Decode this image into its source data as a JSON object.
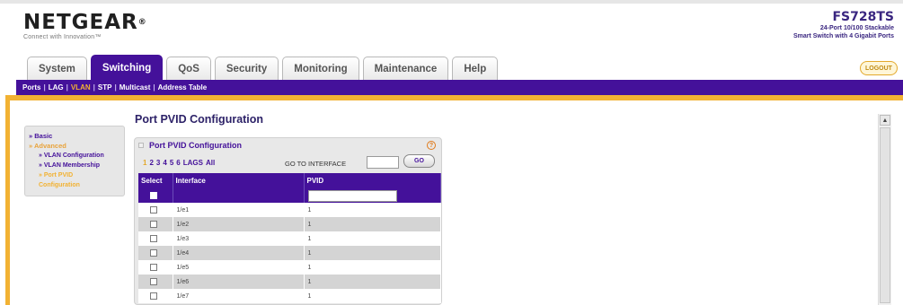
{
  "brand": {
    "logo_text": "NETGEAR",
    "logo_reg": "®",
    "tagline": "Connect with Innovation™"
  },
  "model": {
    "name": "FS728TS",
    "line1": "24-Port 10/100 Stackable",
    "line2": "Smart Switch with 4 Gigabit Ports"
  },
  "tabs": [
    {
      "label": "System",
      "active": false
    },
    {
      "label": "Switching",
      "active": true
    },
    {
      "label": "QoS",
      "active": false
    },
    {
      "label": "Security",
      "active": false
    },
    {
      "label": "Monitoring",
      "active": false
    },
    {
      "label": "Maintenance",
      "active": false
    },
    {
      "label": "Help",
      "active": false
    }
  ],
  "logout_label": "LOGOUT",
  "subnav": [
    {
      "label": "Ports",
      "active": false
    },
    {
      "label": "LAG",
      "active": false
    },
    {
      "label": "VLAN",
      "active": true
    },
    {
      "label": "STP",
      "active": false
    },
    {
      "label": "Multicast",
      "active": false
    },
    {
      "label": "Address Table",
      "active": false
    }
  ],
  "sidemenu": {
    "basic": "» Basic",
    "advanced": "» Advanced",
    "vlan_config": "» VLAN Configuration",
    "vlan_membership": "» VLAN Membership",
    "port_pvid_1": "» Port PVID",
    "port_pvid_2": "Configuration"
  },
  "page_title": "Port PVID Configuration",
  "panel": {
    "title": "Port PVID Configuration",
    "help_symbol": "?",
    "pages": [
      "1",
      "2",
      "3",
      "4",
      "5",
      "6",
      "LAGS",
      "All"
    ],
    "active_page": "1",
    "goto_label": "GO TO INTERFACE",
    "goto_value": "",
    "go_button": "GO"
  },
  "table": {
    "headers": [
      "Select",
      "Interface",
      "PVID"
    ],
    "rows": [
      {
        "interface": "1/e1",
        "pvid": "1"
      },
      {
        "interface": "1/e2",
        "pvid": "1"
      },
      {
        "interface": "1/e3",
        "pvid": "1"
      },
      {
        "interface": "1/e4",
        "pvid": "1"
      },
      {
        "interface": "1/e5",
        "pvid": "1"
      },
      {
        "interface": "1/e6",
        "pvid": "1"
      },
      {
        "interface": "1/e7",
        "pvid": "1"
      }
    ]
  },
  "colors": {
    "brand_purple": "#44119a",
    "accent_gold": "#f2b233"
  }
}
